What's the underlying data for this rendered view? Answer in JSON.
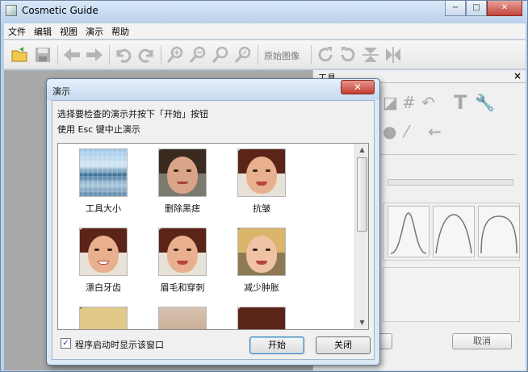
{
  "app": {
    "title": "Cosmetic Guide"
  },
  "window_controls": {
    "minimize": "−",
    "maximize": "□",
    "close": "✕"
  },
  "menu": [
    "文件",
    "编辑",
    "视图",
    "演示",
    "帮助"
  ],
  "toolbar": {
    "original_image_label": "原始图像",
    "icons": [
      "open-icon",
      "save-icon",
      "back-arrow-icon",
      "forward-arrow-icon",
      "undo-icon",
      "redo-icon",
      "zoom-in-icon",
      "zoom-out-icon",
      "zoom-fit-icon",
      "zoom-actual-icon",
      "rotate-cw-icon",
      "rotate-ccw-icon",
      "flip-vertical-icon",
      "flip-horizontal-icon"
    ]
  },
  "tools_panel": {
    "title": "工具",
    "close_label": "×",
    "cancel_label": "取消"
  },
  "dialog": {
    "title": "演示",
    "close_label": "✕",
    "instruction_1": "选择要检查的演示并按下「开始」按钮",
    "instruction_2": "使用 Esc 键中止演示",
    "demos": [
      {
        "label": "工具大小",
        "thumb": "landscape"
      },
      {
        "label": "删除黑痣",
        "thumb": "face-dark"
      },
      {
        "label": "抗皱",
        "thumb": "face-smile"
      },
      {
        "label": "漂白牙齿",
        "thumb": "face-smile"
      },
      {
        "label": "眉毛和穿刺",
        "thumb": "face-smile"
      },
      {
        "label": "减少肿胀",
        "thumb": "face-blonde"
      },
      {
        "label": "",
        "thumb": "face-blonde"
      },
      {
        "label": "",
        "thumb": "partial"
      },
      {
        "label": "",
        "thumb": "face-smile"
      }
    ],
    "show_on_startup": {
      "checked": true,
      "mark": "✓",
      "label": "程序启动时显示该窗口"
    },
    "start_label": "开始",
    "close_button_label": "关闭"
  },
  "colors": {
    "titlebar": "#c7dbf0",
    "dialog_close": "#c23d31",
    "workspace": "#a9a9a9",
    "hair_dark": "#5a2418",
    "hair_blonde": "#d9b66b"
  }
}
